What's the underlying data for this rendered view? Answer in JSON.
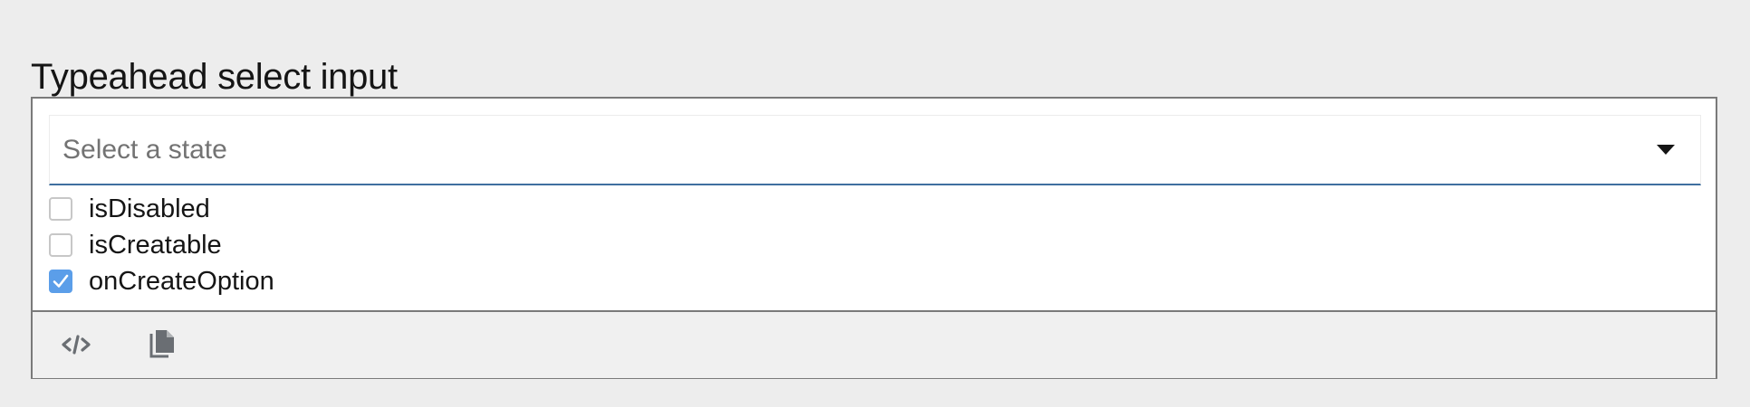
{
  "section": {
    "title": "Typeahead select input"
  },
  "select": {
    "placeholder": "Select a state",
    "value": "",
    "toggle_icon": "caret-down-icon"
  },
  "options": [
    {
      "label": "isDisabled",
      "checked": false
    },
    {
      "label": "isCreatable",
      "checked": false
    },
    {
      "label": "onCreateOption",
      "checked": true
    }
  ],
  "toolbar": {
    "items": [
      {
        "icon": "code-icon"
      },
      {
        "icon": "copy-icon"
      }
    ]
  },
  "colors": {
    "page_background": "#ededed",
    "checkbox_checked": "#5b9ee9",
    "input_underline": "#3f6fa0",
    "icon_color": "#6a6e73"
  }
}
